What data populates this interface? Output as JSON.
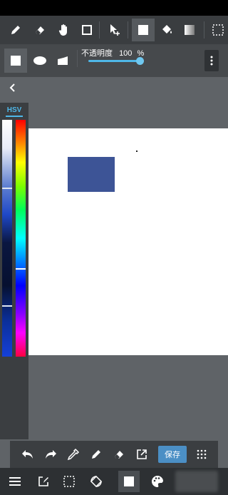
{
  "colors": {
    "accent": "#4fb7e8",
    "toolbar_bg": "#3a3d40",
    "canvas_bg": "#ffffff",
    "drawn_rect": "#3d5496",
    "save_button": "#4b8fc5"
  },
  "toolbar": {
    "tools": [
      "pen-icon",
      "eraser-icon",
      "hand-icon",
      "rectangle-select-icon",
      "move-icon",
      "fill-rect-icon",
      "bucket-icon",
      "gradient-icon",
      "selection-icon"
    ]
  },
  "subtoolbar": {
    "opacity_label": "不透明度",
    "opacity_value": "100",
    "opacity_unit": "%",
    "opacity_fraction": 1.0
  },
  "color_panel": {
    "mode_label": "HSV"
  },
  "bottom_toolbar": {
    "save_label": "保存"
  }
}
